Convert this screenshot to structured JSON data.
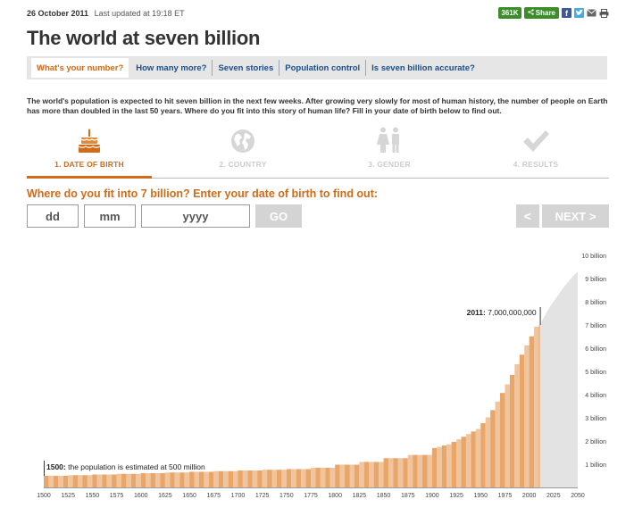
{
  "topbar": {
    "date": "26 October 2011",
    "updated": "Last updated at 19:18 ET",
    "share_count": "361K",
    "share_label": "Share",
    "facebook_glyph": "f"
  },
  "title": "The world at seven billion",
  "tabs": [
    {
      "label": "What's your number?",
      "active": true
    },
    {
      "label": "How many more?",
      "active": false
    },
    {
      "label": "Seven stories",
      "active": false
    },
    {
      "label": "Population control",
      "active": false
    },
    {
      "label": "Is seven billion accurate?",
      "active": false
    }
  ],
  "intro": "The world's population is expected to hit seven billion in the next few weeks. After growing very slowly for most of human history, the number of people on Earth has more than doubled in the last 50 years. Where do you fit into this story of human life? Fill in your date of birth below to find out.",
  "steps": [
    {
      "label": "1. DATE OF BIRTH",
      "icon": "birthday-cake-icon",
      "active": true
    },
    {
      "label": "2. COUNTRY",
      "icon": "globe-icon",
      "active": false
    },
    {
      "label": "3. GENDER",
      "icon": "gender-icon",
      "active": false
    },
    {
      "label": "4. RESULTS",
      "icon": "checkmark-icon",
      "active": false
    }
  ],
  "form": {
    "question": "Where do you fit into 7 billion? Enter your date of birth to find out:",
    "dd_placeholder": "dd",
    "mm_placeholder": "mm",
    "yyyy_placeholder": "yyyy",
    "go_label": "GO",
    "prev_label": "<",
    "next_label": "NEXT >"
  },
  "colors": {
    "accent": "#d06b1a",
    "bar_fill": "#e8a66a",
    "bar_light": "#f0c49c",
    "projection": "#e3e3e3",
    "link": "#1a4e8a"
  },
  "chart_data": {
    "type": "area",
    "x_ticks": [
      1500,
      1525,
      1550,
      1575,
      1600,
      1625,
      1650,
      1675,
      1700,
      1725,
      1750,
      1775,
      1800,
      1825,
      1850,
      1875,
      1900,
      1925,
      1950,
      1975,
      2000,
      2025,
      2050
    ],
    "y_ticks": [
      "1 billion",
      "2 billion",
      "3 billion",
      "4 billion",
      "5 billion",
      "6 billion",
      "7 billion",
      "8 billion",
      "9 billion",
      "10 billion"
    ],
    "xlim": [
      1500,
      2050
    ],
    "ylim": [
      0,
      10
    ],
    "series": [
      {
        "name": "",
        "x": [
          1500,
          1750,
          1775,
          1800,
          1825,
          1850,
          1875,
          1900,
          1910,
          1920,
          1930,
          1940,
          1950,
          1955,
          1960,
          1965,
          1970,
          1975,
          1980,
          1985,
          1990,
          1995,
          2000,
          2005,
          2011
        ],
        "y": [
          0.5,
          0.79,
          0.85,
          0.98,
          1.1,
          1.26,
          1.4,
          1.65,
          1.75,
          1.86,
          2.07,
          2.3,
          2.52,
          2.77,
          3.02,
          3.33,
          3.7,
          4.07,
          4.44,
          4.85,
          5.31,
          5.72,
          6.12,
          6.51,
          7.0
        ]
      },
      {
        "name": "",
        "x": [
          2011,
          2020,
          2025,
          2030,
          2035,
          2040,
          2045,
          2050
        ],
        "y": [
          7.0,
          7.7,
          8.0,
          8.3,
          8.6,
          8.85,
          9.1,
          9.3
        ]
      }
    ],
    "annotations": [
      {
        "year_label": "1500:",
        "text": "the population is estimated at 500 million",
        "x": 1500,
        "y": 0.5
      },
      {
        "year_label": "2011:",
        "text": "7,000,000,000",
        "x": 2011,
        "y": 7.0
      }
    ]
  }
}
